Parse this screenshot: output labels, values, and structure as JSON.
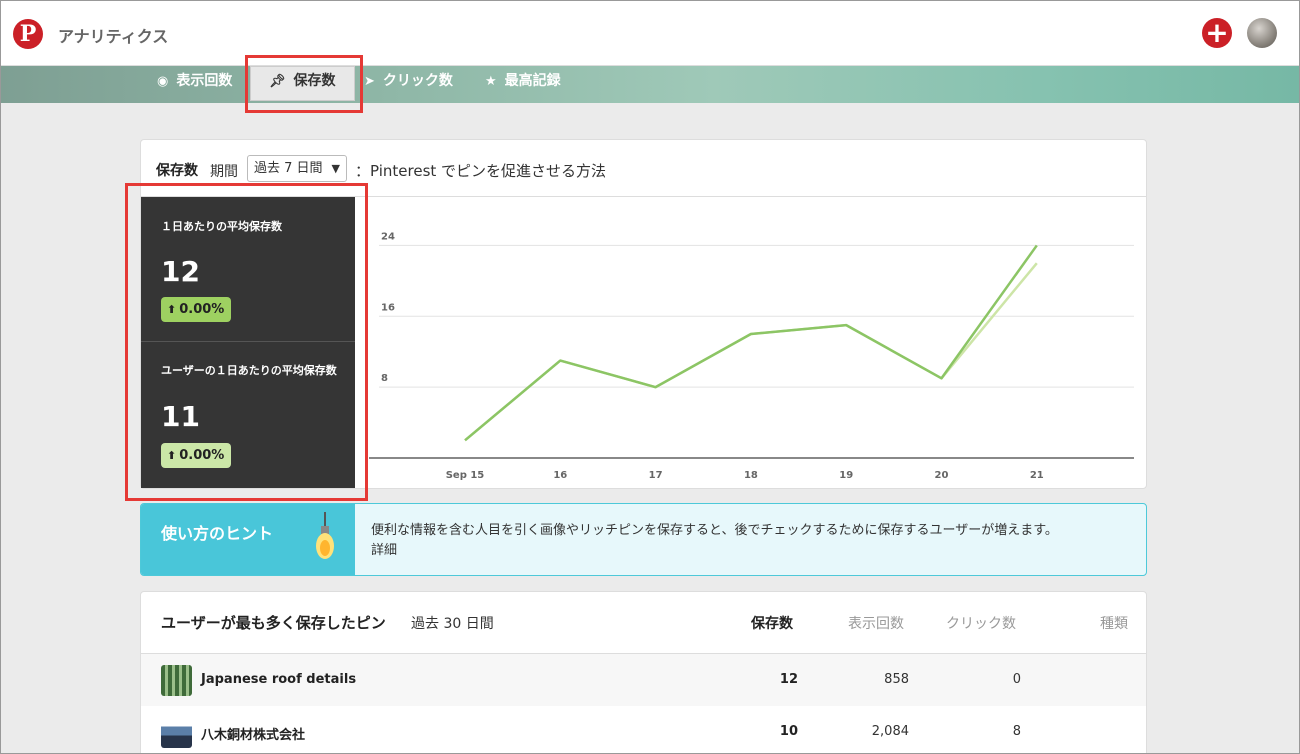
{
  "header": {
    "logo": "P",
    "app_title": "アナリティクス",
    "add_icon": "plus-icon"
  },
  "nav": {
    "items": [
      {
        "label": "表示回数",
        "icon": "eye-icon"
      },
      {
        "label": "保存数",
        "icon": "pin-icon"
      },
      {
        "label": "クリック数",
        "icon": "cursor-icon"
      },
      {
        "label": "最高記録",
        "icon": "star-icon"
      }
    ],
    "active": "保存数"
  },
  "card": {
    "title": "保存数",
    "period_label": "期間",
    "period_value": "過去 7 日間",
    "promo_text": "：Pinterest でピンを促進させる方法"
  },
  "stats": [
    {
      "label": "１日あたりの平均保存数",
      "value": "12",
      "change": "0.00%"
    },
    {
      "label": "ユーザーの１日あたりの平均保存数",
      "value": "11",
      "change": "0.00%"
    }
  ],
  "chart_data": {
    "type": "line",
    "x": [
      "Sep 15",
      "16",
      "17",
      "18",
      "19",
      "20",
      "21"
    ],
    "y_ticks": [
      8,
      16,
      24
    ],
    "ylim": [
      0,
      28
    ],
    "series": [
      {
        "values": [
          2,
          11,
          8,
          14,
          15,
          9,
          24
        ],
        "color": "#8cc565"
      },
      {
        "values": [
          2,
          11,
          8,
          14,
          15,
          9,
          22
        ],
        "color": "#cde5a7"
      }
    ],
    "grid": true
  },
  "hint": {
    "title": "使い方のヒント",
    "text": "便利な情報を含む人目を引く画像やリッチピンを保存すると、後でチェックするために保存するユーザーが増えます。",
    "link": "詳細"
  },
  "table": {
    "title": "ユーザーが最も多く保存したピン",
    "period": "過去 30 日間",
    "columns": [
      "保存数",
      "表示回数",
      "クリック数",
      "種類"
    ],
    "rows": [
      {
        "name": "Japanese roof details",
        "saves": "12",
        "impressions": "858",
        "clicks": "0"
      },
      {
        "name": "八木銅材株式会社",
        "saves": "10",
        "impressions": "2,084",
        "clicks": "8"
      }
    ]
  }
}
